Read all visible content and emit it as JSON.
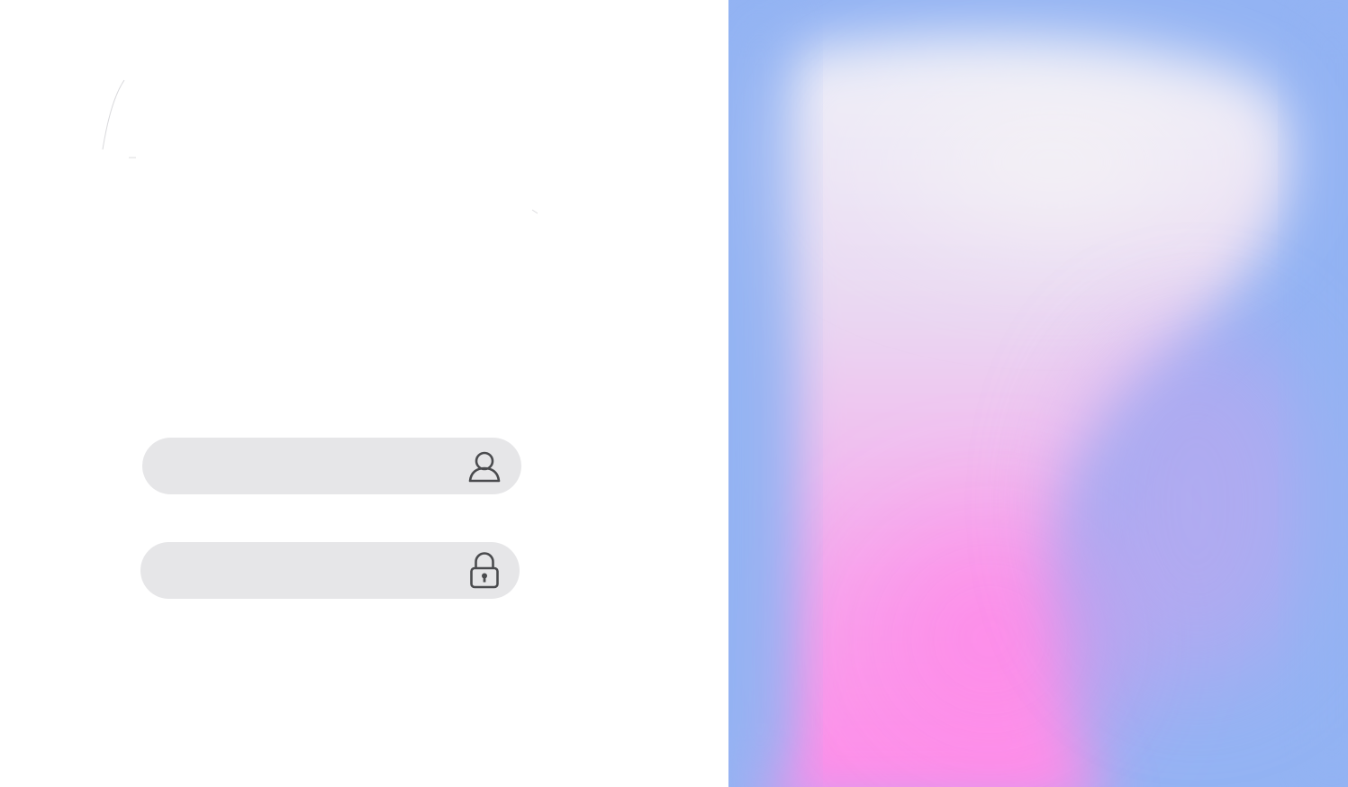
{
  "login_form": {
    "username_field": {
      "value": "",
      "placeholder": "",
      "icon": "user-icon"
    },
    "password_field": {
      "value": "",
      "placeholder": "",
      "icon": "lock-icon"
    }
  },
  "colors": {
    "field_background": "#e6e6e8",
    "icon_stroke": "#4a4b4e",
    "gradient_blue": "#93b3f3",
    "gradient_pink": "#ff86e8",
    "gradient_white": "#f4f2f6"
  }
}
